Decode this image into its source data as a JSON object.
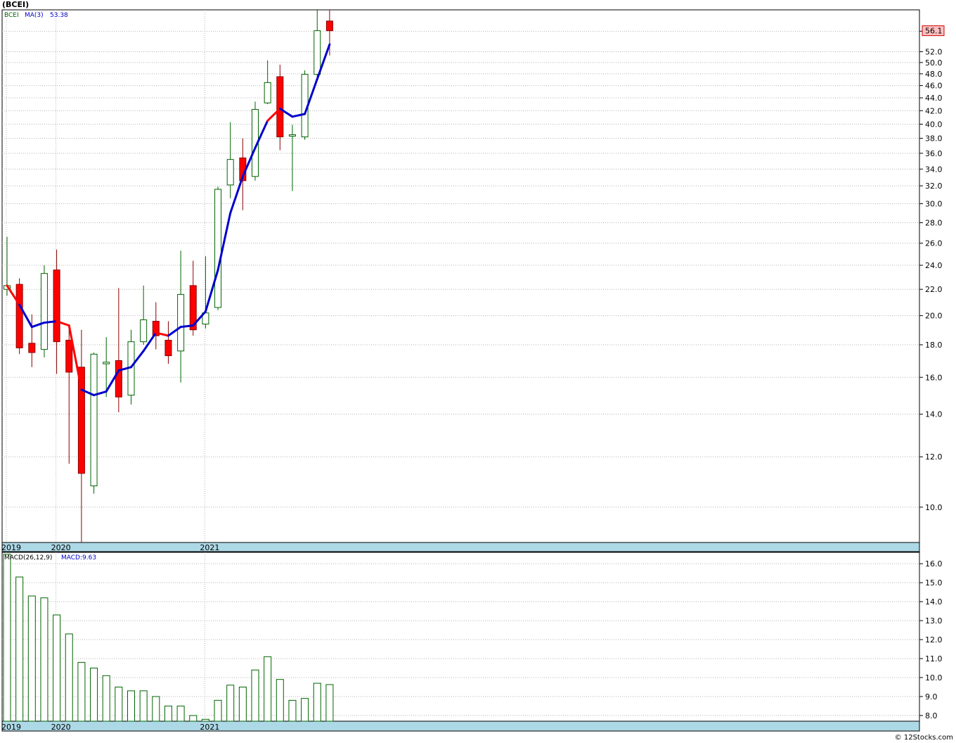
{
  "title": "(BCEI)",
  "credit": "© 12Stocks.com",
  "chart_data": [
    {
      "type": "candlestick",
      "symbol": "BCEI",
      "legend": {
        "symbol": "BCEI",
        "ma_label": "MA(3)",
        "ma_value": "53.38"
      },
      "last_price_label": "56.1",
      "y_scale": "log",
      "ylim": [
        8.8,
        60.5
      ],
      "y_ticks": [
        "10.0",
        "12.0",
        "14.0",
        "16.0",
        "18.0",
        "20.0",
        "22.0",
        "24.0",
        "26.0",
        "28.0",
        "30.0",
        "32.0",
        "34.0",
        "36.0",
        "38.0",
        "40.0",
        "42.0",
        "44.0",
        "46.0",
        "48.0",
        "50.0",
        "52.0",
        "56.0"
      ],
      "year_labels": [
        {
          "label": "2019",
          "index": 0
        },
        {
          "label": "2020",
          "index": 4
        },
        {
          "label": "2021",
          "index": 16
        }
      ],
      "candles": [
        {
          "o": 22.0,
          "h": 26.6,
          "l": 21.5,
          "c": 22.3
        },
        {
          "o": 22.4,
          "h": 22.9,
          "l": 17.4,
          "c": 17.8
        },
        {
          "o": 18.1,
          "h": 20.1,
          "l": 16.6,
          "c": 17.5
        },
        {
          "o": 17.7,
          "h": 24.0,
          "l": 17.2,
          "c": 23.3
        },
        {
          "o": 23.6,
          "h": 25.4,
          "l": 16.2,
          "c": 18.2
        },
        {
          "o": 18.3,
          "h": 19.3,
          "l": 11.7,
          "c": 16.3
        },
        {
          "o": 16.6,
          "h": 19.0,
          "l": 8.8,
          "c": 11.3
        },
        {
          "o": 10.8,
          "h": 17.5,
          "l": 10.5,
          "c": 17.4
        },
        {
          "o": 16.8,
          "h": 18.5,
          "l": 14.9,
          "c": 16.9
        },
        {
          "o": 17.0,
          "h": 22.1,
          "l": 14.1,
          "c": 14.9
        },
        {
          "o": 15.0,
          "h": 19.0,
          "l": 14.5,
          "c": 18.2
        },
        {
          "o": 18.2,
          "h": 22.3,
          "l": 18.0,
          "c": 19.7
        },
        {
          "o": 19.6,
          "h": 21.0,
          "l": 17.7,
          "c": 18.6
        },
        {
          "o": 18.3,
          "h": 19.6,
          "l": 16.8,
          "c": 17.3
        },
        {
          "o": 17.6,
          "h": 25.3,
          "l": 15.7,
          "c": 21.6
        },
        {
          "o": 22.3,
          "h": 24.4,
          "l": 18.6,
          "c": 19.0
        },
        {
          "o": 19.4,
          "h": 24.8,
          "l": 19.1,
          "c": 20.2
        },
        {
          "o": 20.6,
          "h": 31.9,
          "l": 20.4,
          "c": 31.6
        },
        {
          "o": 32.1,
          "h": 40.3,
          "l": 30.6,
          "c": 35.2
        },
        {
          "o": 35.4,
          "h": 38.0,
          "l": 29.3,
          "c": 32.6
        },
        {
          "o": 33.1,
          "h": 43.4,
          "l": 32.6,
          "c": 42.2
        },
        {
          "o": 43.2,
          "h": 50.4,
          "l": 43.0,
          "c": 46.5
        },
        {
          "o": 47.5,
          "h": 49.6,
          "l": 36.4,
          "c": 38.2
        },
        {
          "o": 38.3,
          "h": 39.9,
          "l": 31.4,
          "c": 38.5
        },
        {
          "o": 38.2,
          "h": 48.6,
          "l": 37.8,
          "c": 47.9
        },
        {
          "o": 47.9,
          "h": 60.4,
          "l": 47.5,
          "c": 56.1
        },
        {
          "o": 58.1,
          "h": 60.4,
          "l": 51.3,
          "c": 56.1
        }
      ],
      "ma": [
        22.3,
        20.8,
        19.2,
        19.5,
        19.6,
        19.3,
        15.3,
        15.0,
        15.2,
        16.4,
        16.6,
        17.6,
        18.8,
        18.6,
        19.2,
        19.3,
        20.3,
        23.6,
        29.0,
        33.1,
        36.7,
        40.5,
        42.3,
        41.1,
        41.5,
        47.1,
        53.38
      ],
      "ma_colors": [
        "#ff0000",
        "#ff0000",
        "#0000cc",
        "#0000cc",
        "#0000cc",
        "#ff0000",
        "#ff0000",
        "#0000cc",
        "#0000cc",
        "#0000cc",
        "#0000cc",
        "#0000cc",
        "#0000cc",
        "#ff0000",
        "#0000cc",
        "#0000cc",
        "#0000cc",
        "#0000cc",
        "#0000cc",
        "#0000cc",
        "#0000cc",
        "#0000cc",
        "#ff0000",
        "#0000cc",
        "#0000cc",
        "#0000cc",
        "#0000cc"
      ]
    },
    {
      "type": "bar",
      "name": "MACD(26,12,9)",
      "legend": {
        "label": "MACD(26,12,9)",
        "value_label": "MACD:9.63"
      },
      "ylim": [
        7.7,
        16.6
      ],
      "y_ticks": [
        "8.0",
        "9.0",
        "10.0",
        "11.0",
        "12.0",
        "13.0",
        "14.0",
        "15.0",
        "16.0"
      ],
      "year_labels": [
        {
          "label": "2019",
          "index": 0
        },
        {
          "label": "2020",
          "index": 4
        },
        {
          "label": "2021",
          "index": 16
        }
      ],
      "values": [
        16.5,
        15.3,
        14.3,
        14.2,
        13.3,
        12.3,
        10.8,
        10.5,
        10.1,
        9.5,
        9.3,
        9.3,
        9.0,
        8.5,
        8.5,
        8.0,
        7.8,
        8.8,
        9.6,
        9.5,
        10.4,
        11.1,
        9.9,
        8.8,
        8.9,
        9.7,
        9.63
      ]
    }
  ],
  "colors": {
    "up": "#ffffff",
    "up_stroke": "#006400",
    "down": "#ff0000",
    "down_stroke": "#8b0000",
    "ma_up": "#0000cc",
    "ma_down": "#ff0000",
    "macd": "#006400",
    "year_strip": "#add8e6",
    "grid": "#b4b4b4",
    "price_badge": "#ffc0c0"
  }
}
